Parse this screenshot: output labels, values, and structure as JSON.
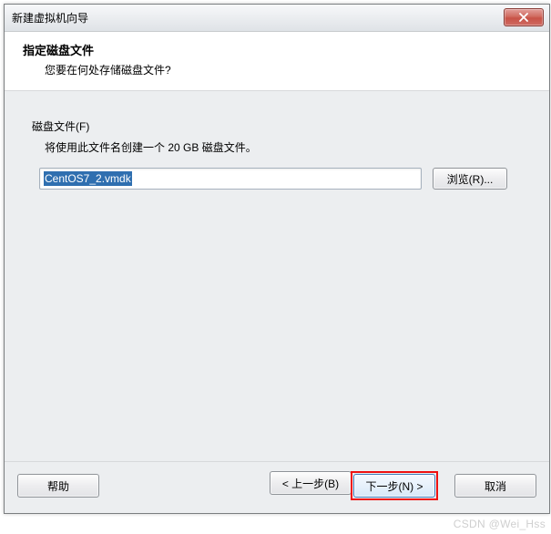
{
  "window": {
    "title": "新建虚拟机向导"
  },
  "header": {
    "title": "指定磁盘文件",
    "subtitle": "您要在何处存储磁盘文件?"
  },
  "disk": {
    "section_label": "磁盘文件(F)",
    "description": "将使用此文件名创建一个 20 GB 磁盘文件。",
    "file_value": "CentOS7_2.vmdk",
    "browse_label": "浏览(R)..."
  },
  "buttons": {
    "help": "帮助",
    "back": "< 上一步(B)",
    "next": "下一步(N) >",
    "cancel": "取消"
  },
  "watermark": "CSDN @Wei_Hss"
}
